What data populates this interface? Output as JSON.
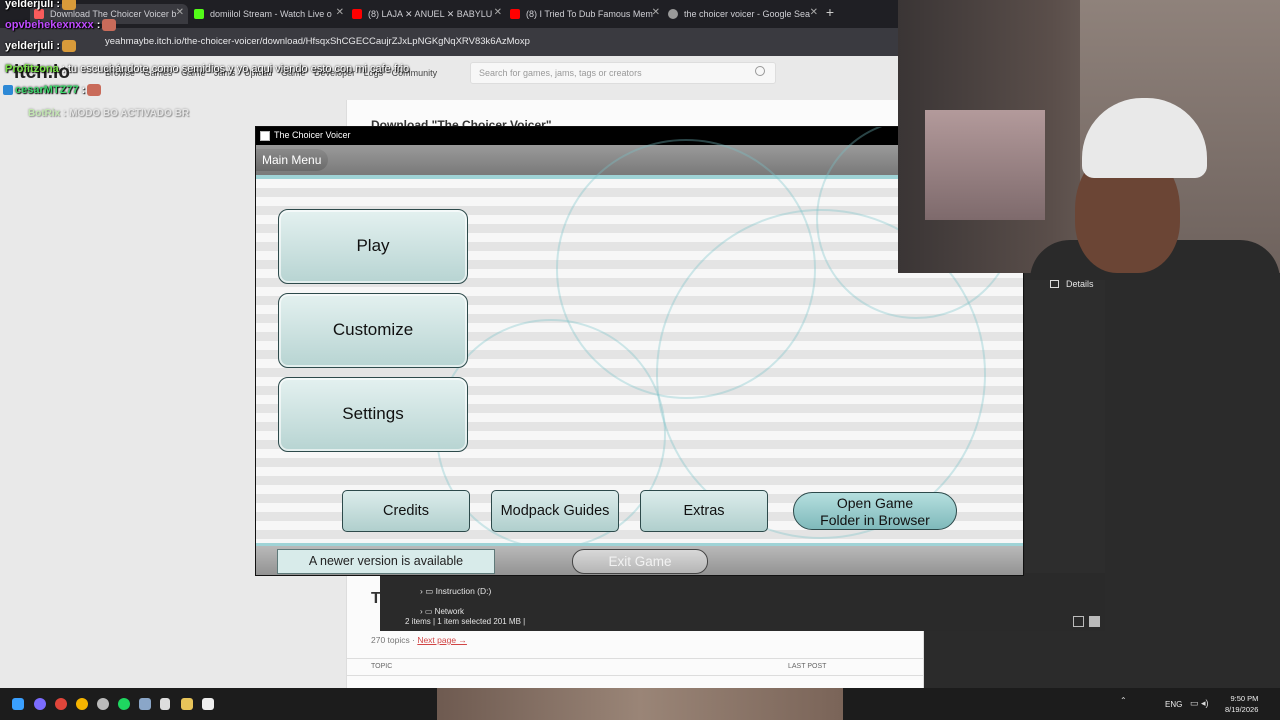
{
  "browser": {
    "tabs": [
      {
        "label": "Download The Choicer Voicer b"
      },
      {
        "label": "domiilol Stream - Watch Live o"
      },
      {
        "label": "(8) LAJA ✕ ANUEL ✕ BABYLU"
      },
      {
        "label": "(8) I Tried To Dub Famous Mem"
      },
      {
        "label": "the choicer voicer - Google Sea"
      }
    ],
    "new_tab": "+",
    "url": "yeahmaybe.itch.io/the-choicer-voicer/download/HfsqxShCGECCaujrZJxLpNGKgNqXRV83k6AzMoxp"
  },
  "itch": {
    "logo": "itch.io",
    "nav": "Browse Games  Game Jams  Upload Game  Developer Logs  Community",
    "search_placeholder": "Search for games, jams, tags or creators",
    "download_title": "Download \"The Choicer Voicer\"",
    "topic_count": "270 topics · ",
    "next_page": "Next page →",
    "col_topic": "TOPIC",
    "col_last_post": "LAST POST",
    "t_letter": "T"
  },
  "explorer": {
    "details": "Details",
    "drive": "Instruction (D:)",
    "network": "Network",
    "status": "2 items  |  1 item selected  201 MB  |"
  },
  "game": {
    "window_title": "The Choicer Voicer",
    "header_label": "Main Menu",
    "play": "Play",
    "customize": "Customize",
    "settings": "Settings",
    "credits": "Credits",
    "modpack_guides": "Modpack Guides",
    "extras": "Extras",
    "open_folder_line1": "Open Game",
    "open_folder_line2": "Folder in Browser",
    "update_notice": "A newer version is available",
    "exit_game": "Exit Game"
  },
  "chat": [
    {
      "user": "yelderjuli",
      "text": " :",
      "color": "#ffffff"
    },
    {
      "user": "opvbehekexnxxx",
      "text": " :",
      "color": "#c04cff"
    },
    {
      "user": "yelderjuli",
      "text": " :",
      "color": "#ffffff"
    },
    {
      "user": "Profitzona",
      "text": " : tu escuchándote como semidios y yo aqui viendo esto con mi cafe frio",
      "color": "#7ce34a"
    },
    {
      "user": "cesarMTZ77",
      "text": " :",
      "color": "#3fd86e"
    },
    {
      "user": "BotRix",
      "text": " : MODO BO ACTIVADO BR",
      "color": "#7ce34a"
    }
  ],
  "tray": {
    "lang": "ENG",
    "time": "9:50 PM",
    "date": "8/19/2026"
  }
}
